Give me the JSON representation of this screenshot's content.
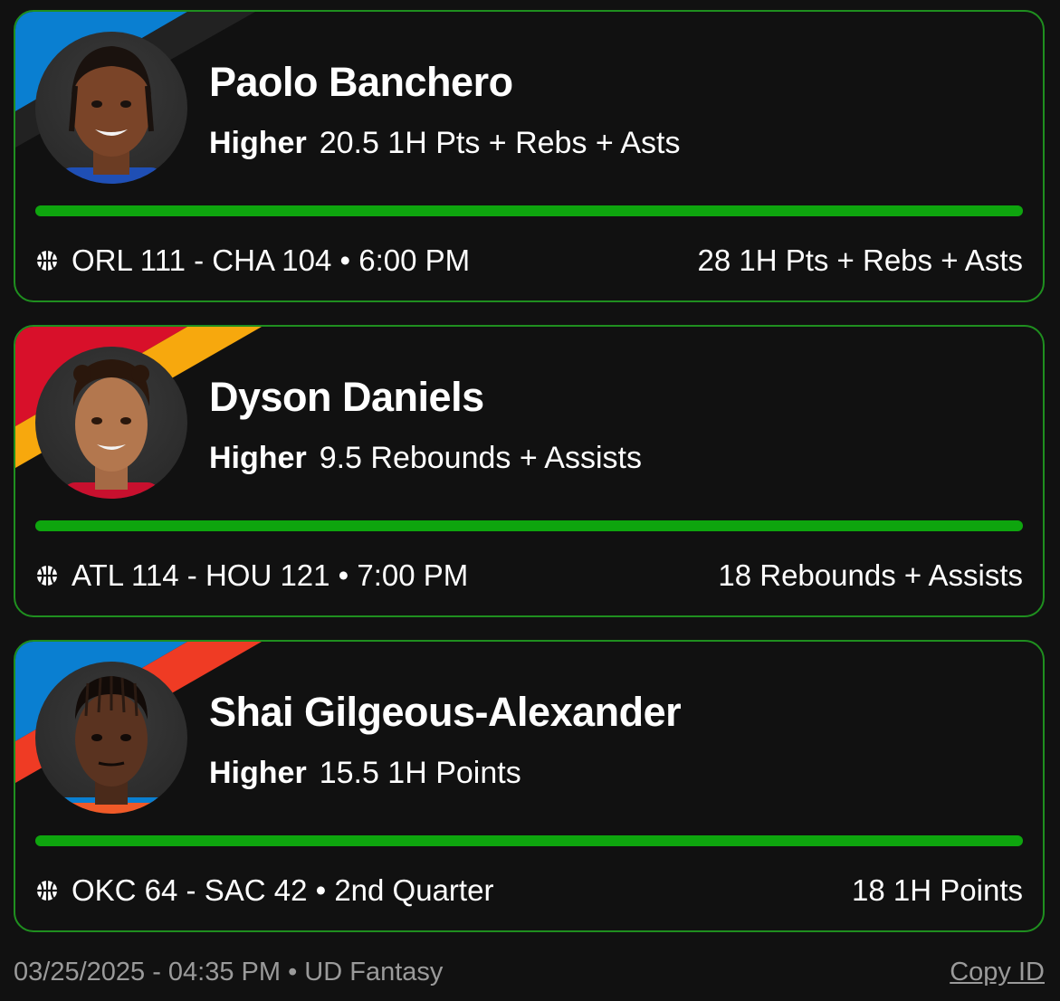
{
  "picks": [
    {
      "player_name": "Paolo Banchero",
      "direction": "Higher",
      "line": "20.5 1H Pts + Rebs + Asts",
      "game": "ORL 111 - CHA 104 • 6:00 PM",
      "result": "28 1H Pts + Rebs + Asts",
      "progress": 1.0,
      "team_colors": [
        "#0a7fd1",
        "#1e1e1e"
      ],
      "jersey_color": "#1f4fb5"
    },
    {
      "player_name": "Dyson Daniels",
      "direction": "Higher",
      "line": "9.5 Rebounds + Assists",
      "game": "ATL 114 - HOU 121 • 7:00 PM",
      "result": "18 Rebounds + Assists",
      "progress": 1.0,
      "team_colors": [
        "#d8102a",
        "#f7a80d"
      ],
      "jersey_color": "#c8102e"
    },
    {
      "player_name": "Shai Gilgeous-Alexander",
      "direction": "Higher",
      "line": "15.5 1H Points",
      "game": "OKC 64 - SAC 42 • 2nd Quarter",
      "result": "18 1H Points",
      "progress": 1.0,
      "team_colors": [
        "#0a7fd1",
        "#ef3b24"
      ],
      "jersey_color": "#f05a28"
    }
  ],
  "footer": {
    "timestamp": "03/25/2025 - 04:35 PM • UD Fantasy",
    "copy_id": "Copy ID"
  },
  "colors": {
    "accent_green": "#0ea50e",
    "card_border": "#1f8f1f",
    "background": "#111111"
  },
  "icons": {
    "sport": "basketball-icon"
  }
}
